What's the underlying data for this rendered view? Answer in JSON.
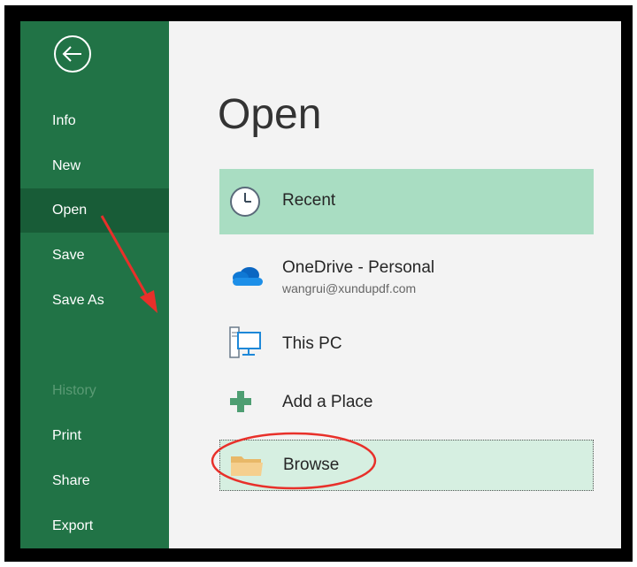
{
  "sidebar": {
    "items": [
      {
        "label": "Info",
        "state": "normal"
      },
      {
        "label": "New",
        "state": "normal"
      },
      {
        "label": "Open",
        "state": "active"
      },
      {
        "label": "Save",
        "state": "normal"
      },
      {
        "label": "Save As",
        "state": "normal"
      },
      {
        "label": "History",
        "state": "disabled"
      },
      {
        "label": "Print",
        "state": "normal"
      },
      {
        "label": "Share",
        "state": "normal"
      },
      {
        "label": "Export",
        "state": "normal"
      }
    ]
  },
  "main": {
    "title": "Open",
    "locations": [
      {
        "label": "Recent",
        "icon": "clock-icon",
        "selected": true
      },
      {
        "label": "OneDrive - Personal",
        "sublabel": "wangrui@xundupdf.com",
        "icon": "cloud-icon"
      },
      {
        "label": "This PC",
        "icon": "computer-icon"
      },
      {
        "label": "Add a Place",
        "icon": "plus-icon"
      },
      {
        "label": "Browse",
        "icon": "folder-icon",
        "highlighted": true
      }
    ]
  },
  "colors": {
    "sidebar_bg": "#217346",
    "sidebar_active": "#185c37",
    "recent_bg": "#a9ddc2",
    "browse_bg": "#d6efe1",
    "annotation_red": "#e8302a"
  }
}
